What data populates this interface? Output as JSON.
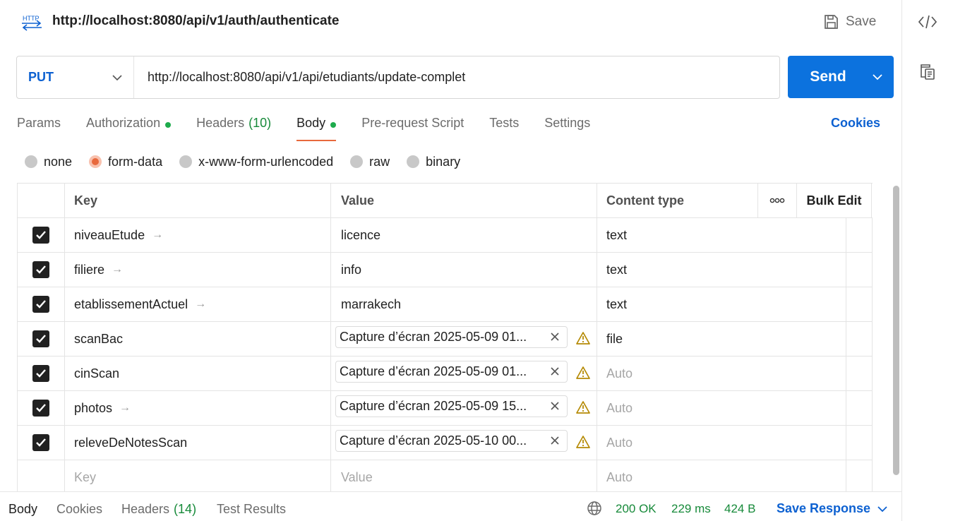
{
  "request": {
    "title": "http://localhost:8080/api/v1/auth/authenticate",
    "http_icon_label": "HTTP",
    "save_label": "Save",
    "method": "PUT",
    "url": "http://localhost:8080/api/v1/api/etudiants/update-complet",
    "send_label": "Send"
  },
  "tabs": [
    {
      "label": "Params",
      "count": "",
      "dot": false,
      "active": false
    },
    {
      "label": "Authorization",
      "count": "",
      "dot": true,
      "active": false
    },
    {
      "label": "Headers",
      "count": "(10)",
      "dot": false,
      "active": false
    },
    {
      "label": "Body",
      "count": "",
      "dot": true,
      "active": true
    },
    {
      "label": "Pre-request Script",
      "count": "",
      "dot": false,
      "active": false
    },
    {
      "label": "Tests",
      "count": "",
      "dot": false,
      "active": false
    },
    {
      "label": "Settings",
      "count": "",
      "dot": false,
      "active": false
    }
  ],
  "cookies_link": "Cookies",
  "body_types": [
    {
      "label": "none",
      "selected": false
    },
    {
      "label": "form-data",
      "selected": true
    },
    {
      "label": "x-www-form-urlencoded",
      "selected": false
    },
    {
      "label": "raw",
      "selected": false
    },
    {
      "label": "binary",
      "selected": false
    }
  ],
  "table": {
    "headers": {
      "key": "Key",
      "value": "Value",
      "content_type": "Content type",
      "bulk_edit": "Bulk Edit"
    },
    "rows": [
      {
        "key": "niveauEtude",
        "arrow": true,
        "value": "licence",
        "file": false,
        "content_type": "text",
        "ct_muted": false
      },
      {
        "key": "filiere",
        "arrow": true,
        "value": "info",
        "file": false,
        "content_type": "text",
        "ct_muted": false
      },
      {
        "key": "etablissementActuel",
        "arrow": true,
        "value": "marrakech",
        "file": false,
        "content_type": "text",
        "ct_muted": false
      },
      {
        "key": "scanBac",
        "arrow": false,
        "value": "Capture d’écran 2025-05-09 01...",
        "file": true,
        "content_type": "file",
        "ct_muted": false
      },
      {
        "key": "cinScan",
        "arrow": false,
        "value": "Capture d’écran 2025-05-09 01...",
        "file": true,
        "content_type": "Auto",
        "ct_muted": true
      },
      {
        "key": "photos",
        "arrow": true,
        "value": "Capture d’écran 2025-05-09 15...",
        "file": true,
        "content_type": "Auto",
        "ct_muted": true
      },
      {
        "key": "releveDeNotesScan",
        "arrow": false,
        "value": "Capture d’écran 2025-05-10 00...",
        "file": true,
        "content_type": "Auto",
        "ct_muted": true
      }
    ],
    "placeholder_row": {
      "key": "Key",
      "value": "Value",
      "content_type": "Auto"
    }
  },
  "response": {
    "tabs": [
      {
        "label": "Body",
        "count": "",
        "active": true
      },
      {
        "label": "Cookies",
        "count": "",
        "active": false
      },
      {
        "label": "Headers",
        "count": "(14)",
        "active": false
      },
      {
        "label": "Test Results",
        "count": "",
        "active": false
      }
    ],
    "status": "200 OK",
    "time": "229 ms",
    "size": "424 B",
    "save_response": "Save Response"
  },
  "colors": {
    "accent": "#0c72de",
    "active_tab": "#e8693d",
    "success": "#178a3a",
    "method": "#0d61d1"
  }
}
